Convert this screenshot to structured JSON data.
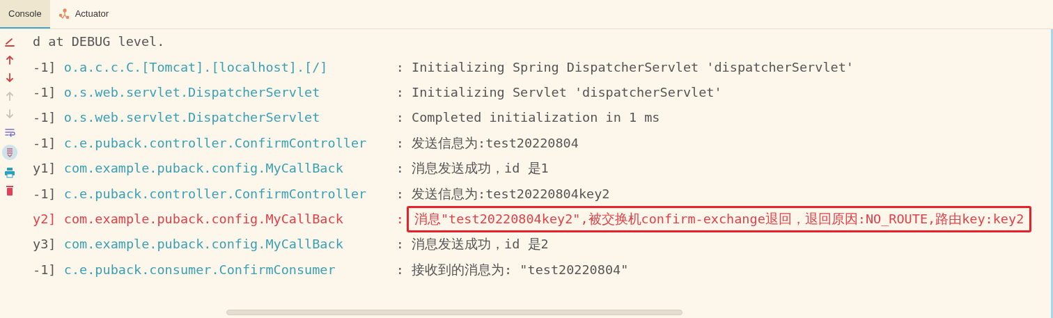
{
  "tabs": [
    {
      "label": "Console",
      "selected": true,
      "kind": "plain"
    },
    {
      "label": "Actuator",
      "selected": false,
      "kind": "actuator"
    }
  ],
  "toolbar": [
    {
      "kind": "clear-line",
      "disabled": false
    },
    {
      "kind": "up",
      "disabled": false
    },
    {
      "kind": "down",
      "disabled": false
    },
    {
      "kind": "up",
      "disabled": true
    },
    {
      "kind": "down",
      "disabled": true
    },
    {
      "kind": "wrap",
      "disabled": false
    },
    {
      "kind": "scroll-end",
      "disabled": false,
      "selected": true
    },
    {
      "kind": "print",
      "disabled": false
    },
    {
      "kind": "trash",
      "disabled": false
    }
  ],
  "log_lines": [
    {
      "kind": "plain",
      "text": "d at DEBUG level."
    },
    {
      "kind": "info",
      "thread": "-1]",
      "logger": "o.a.c.c.C.[Tomcat].[localhost].[/]",
      "message": ": Initializing Spring DispatcherServlet 'dispatcherServlet'"
    },
    {
      "kind": "info",
      "thread": "-1]",
      "logger": "o.s.web.servlet.DispatcherServlet",
      "message": ": Initializing Servlet 'dispatcherServlet'"
    },
    {
      "kind": "info",
      "thread": "-1]",
      "logger": "o.s.web.servlet.DispatcherServlet",
      "message": ": Completed initialization in 1 ms"
    },
    {
      "kind": "info",
      "thread": "-1]",
      "logger": "c.e.puback.controller.ConfirmController",
      "message": ": 发送信息为:test20220804"
    },
    {
      "kind": "info",
      "thread": "y1]",
      "logger": "com.example.puback.config.MyCallBack",
      "message": ": 消息发送成功，id 是1"
    },
    {
      "kind": "info",
      "thread": "-1]",
      "logger": "c.e.puback.controller.ConfirmController",
      "message": ": 发送信息为:test20220804key2"
    },
    {
      "kind": "error",
      "thread": "y2]",
      "logger": "com.example.puback.config.MyCallBack",
      "separator": ":",
      "message": "消息\"test20220804key2\",被交换机confirm-exchange退回，退回原因:NO_ROUTE,路由key:key2",
      "highlighted": true
    },
    {
      "kind": "info",
      "thread": "y3]",
      "logger": "com.example.puback.config.MyCallBack",
      "message": ": 消息发送成功，id 是2"
    },
    {
      "kind": "info",
      "thread": "-1]",
      "logger": "c.e.puback.consumer.ConfirmConsumer",
      "message": ": 接收到的消息为: \"test20220804\""
    }
  ]
}
